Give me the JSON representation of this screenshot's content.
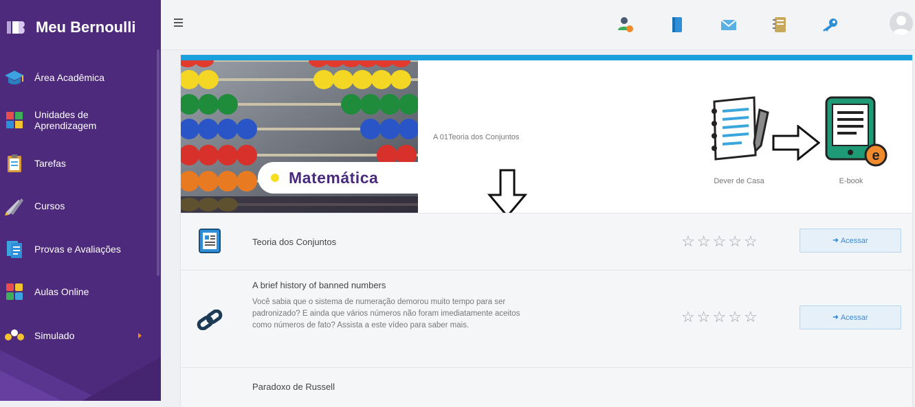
{
  "brand": {
    "name": "Meu Bernoulli"
  },
  "sidebar": {
    "items": [
      {
        "label": "Área Acadêmica",
        "icon": "graduation-cap-icon"
      },
      {
        "label": "Unidades de\nAprendizagem",
        "icon": "puzzle-icon"
      },
      {
        "label": "Tarefas",
        "icon": "clipboard-icon"
      },
      {
        "label": "Cursos",
        "icon": "pencils-icon"
      },
      {
        "label": "Provas e Avaliações",
        "icon": "exam-icon"
      },
      {
        "label": "Aulas Online",
        "icon": "online-class-icon"
      },
      {
        "label": "Simulado",
        "icon": "simulation-icon"
      }
    ]
  },
  "topbar": {
    "icons": [
      "teacher-icon",
      "book-icon",
      "mail-icon",
      "notebook-icon",
      "key-icon",
      "avatar"
    ]
  },
  "lesson": {
    "subject": "Matemática",
    "title": "A 01Teoria dos Conjuntos",
    "resources": [
      {
        "label": "Dever de Casa",
        "icon": "homework-icon"
      },
      {
        "label": "E-book",
        "icon": "ebook-icon"
      }
    ]
  },
  "rows": [
    {
      "title": "Teoria dos Conjuntos",
      "description": "",
      "icon": "document-icon",
      "rating": 0,
      "button": "Acessar"
    },
    {
      "title": "A brief history of banned numbers",
      "description": "Você sabia que o sistema de numeração demorou muito tempo para ser padronizado? E ainda que vários números não foram imediatamente aceitos como números de fato? Assista a este vídeo para saber mais.",
      "icon": "link-icon",
      "rating": 0,
      "button": "Acessar"
    },
    {
      "title": "Paradoxo de Russell",
      "description": "",
      "icon": "",
      "rating": 0,
      "button": ""
    }
  ],
  "colors": {
    "sidebar": "#4e2a7c",
    "accent": "#1aa0dc",
    "subject_text": "#4a2a7c",
    "button_text": "#3a8ad6"
  }
}
